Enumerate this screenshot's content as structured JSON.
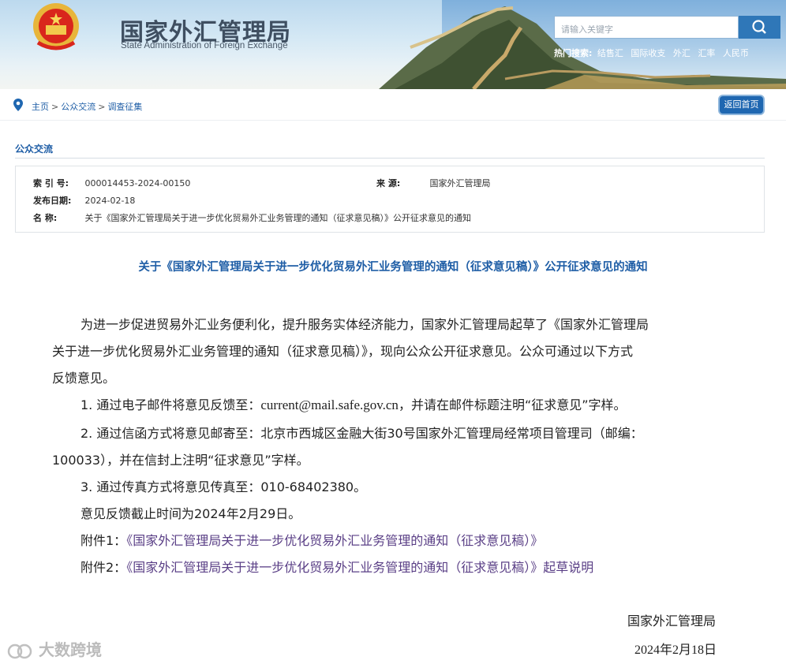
{
  "header": {
    "title_cn": "国家外汇管理局",
    "title_en": "State Administration of Foreign Exchange",
    "search_placeholder": "请输入关键字",
    "hot_label": "热门搜索:",
    "hot_items": [
      "结售汇",
      "国际收支",
      "外汇",
      "汇率",
      "人民币"
    ]
  },
  "breadcrumb": {
    "items": [
      "主页",
      "公众交流",
      "调查征集"
    ],
    "separator": ">",
    "back_label": "返回首页"
  },
  "section_title": "公众交流",
  "meta": {
    "index_label": "索  引  号:",
    "index_value": "000014453-2024-00150",
    "source_label": "来      源:",
    "source_value": "国家外汇管理局",
    "date_label": "发布日期:",
    "date_value": "2024-02-18",
    "name_label": "名      称:",
    "name_value": "关于《国家外汇管理局关于进一步优化贸易外汇业务管理的通知（征求意见稿）》公开征求意见的通知"
  },
  "doc_title": "关于《国家外汇管理局关于进一步优化贸易外汇业务管理的通知（征求意见稿）》公开征求意见的通知",
  "content": {
    "intro_1": "为进一步促进贸易外汇业务便利化，提升服务实体经济能力，国家外汇管理局起草了《国家外汇管理局",
    "intro_2": "关于进一步优化贸易外汇业务管理的通知（征求意见稿）》，现向公众公开征求意见。公众可通过以下方式",
    "intro_3": "反馈意见。",
    "item1_a": "1. 通过电子邮件将意见反馈至：",
    "item1_email": "current@mail.safe.gov.cn",
    "item1_b": "，并请在邮件标题注明“征求意见”字样。",
    "item2_a": "2. 通过信函方式将意见邮寄至：北京市西城区金融大街30号国家外汇管理局经常项目管理司（邮编：",
    "item2_b": "100033），并在信封上注明“征求意见”字样。",
    "item3": "3. 通过传真方式将意见传真至：010-68402380。",
    "deadline": "意见反馈截止时间为2024年2月29日。",
    "att1_label": "附件1：",
    "att1_link": "《国家外汇管理局关于进一步优化贸易外汇业务管理的通知（征求意见稿）》",
    "att2_label": "附件2：",
    "att2_link": "《国家外汇管理局关于进一步优化贸易外汇业务管理的通知（征求意见稿）》起草说明"
  },
  "signature": {
    "org": "国家外汇管理局",
    "date": "2024年2月18日"
  },
  "watermark": "大数跨境",
  "colors": {
    "link_blue": "#1f5ea6",
    "attachment_purple": "#5a3f86",
    "button_blue": "#1f67b1"
  }
}
